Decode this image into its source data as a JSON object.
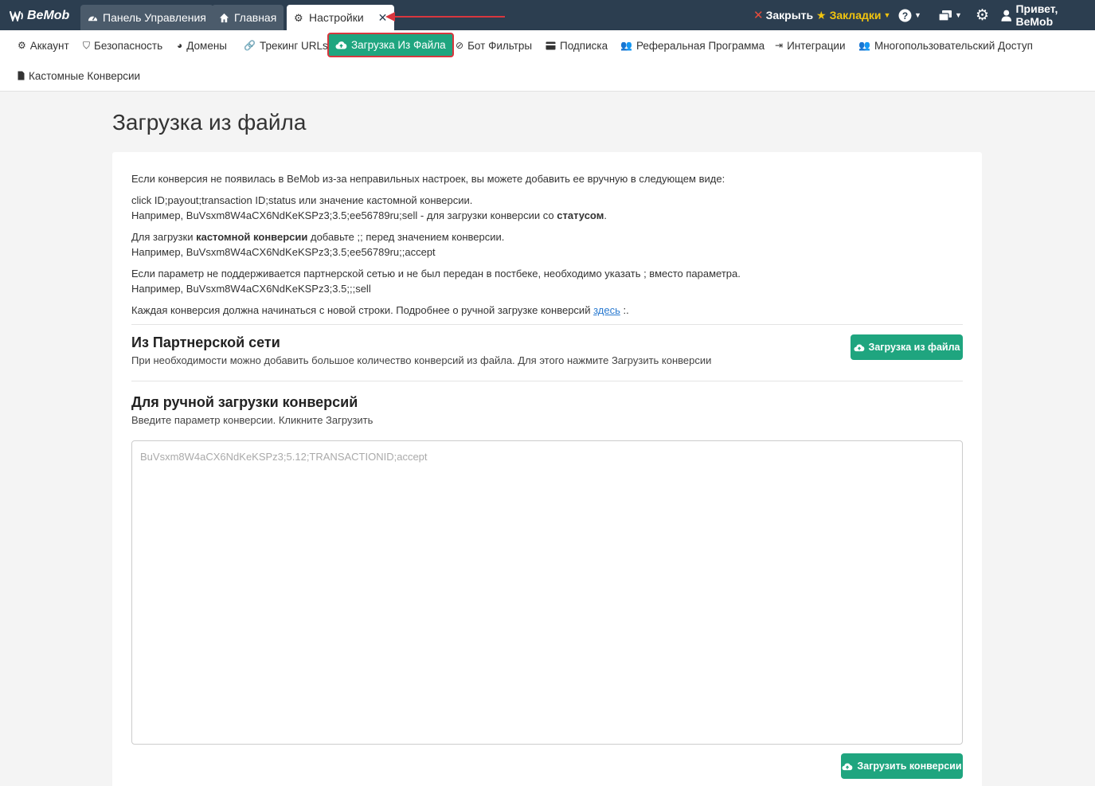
{
  "app": {
    "logo_text": "BeMob"
  },
  "tabs": [
    {
      "label": "Панель Управления"
    },
    {
      "label": "Главная"
    },
    {
      "label": "Настройки",
      "close": "✕"
    }
  ],
  "topmenu": {
    "close_label": "Закрыть",
    "bookmarks_label": "Закладки",
    "user_label": "Привет, BeMob"
  },
  "subnav": [
    {
      "label": "Аккаунт"
    },
    {
      "label": "Безопасность"
    },
    {
      "label": "Домены"
    },
    {
      "label": "Трекинг URLs"
    },
    {
      "label": "Загрузка Из Файла"
    },
    {
      "label": "Бот Фильтры"
    },
    {
      "label": "Подписка"
    },
    {
      "label": "Реферальная Программа"
    },
    {
      "label": "Интеграции"
    },
    {
      "label": "Многопользовательский Доступ"
    },
    {
      "label": "Кастомные Конверсии"
    }
  ],
  "page": {
    "title": "Загрузка из файла",
    "intro": "Если конверсия не появилась в BeMob из-за неправильных настроек, вы можете добавить ее вручную в следующем виде:",
    "format_line": "click ID;payout;transaction ID;status или значение кастомной конверсии.",
    "example1_prefix": "Например, BuVsxm8W4aCX6NdKeKSPz3;3.5;ee56789ru;sell - для загрузки конверсии со ",
    "example1_bold": "статусом",
    "example1_suffix": ".",
    "custom_prefix": "Для загрузки ",
    "custom_bold": "кастомной конверсии",
    "custom_suffix": " добавьте ;; перед значением конверсии.",
    "example2": "Например, BuVsxm8W4aCX6NdKeKSPz3;3.5;ee56789ru;;accept",
    "param_note": "Если параметр не поддерживается партнерской сетью и не был передан в постбеке, необходимо указать ; вместо параметра.",
    "example3": "Например, BuVsxm8W4aCX6NdKeKSPz3;3.5;;;sell",
    "newline_note": "Каждая конверсия должна начинаться с новой строки. Подробнее о ручной загрузке конверсий ",
    "newline_link": "здесь",
    "newline_suffix": " :."
  },
  "partner": {
    "title": "Из Партнерской сети",
    "desc": "При необходимости можно добавить большое количество конверсий из файла. Для этого нажмите Загрузить конверсии",
    "button": "Загрузка из файла"
  },
  "manual": {
    "title": "Для ручной загрузки конверсий",
    "desc": "Введите параметр конверсии. Кликните Загрузить",
    "placeholder": "BuVsxm8W4aCX6NdKeKSPz3;5.12;TRANSACTIONID;accept",
    "button": "Загрузить конверсии"
  },
  "colors": {
    "topbar": "#2c3e50",
    "accent": "#1fa57f",
    "highlight": "#d9363e"
  }
}
